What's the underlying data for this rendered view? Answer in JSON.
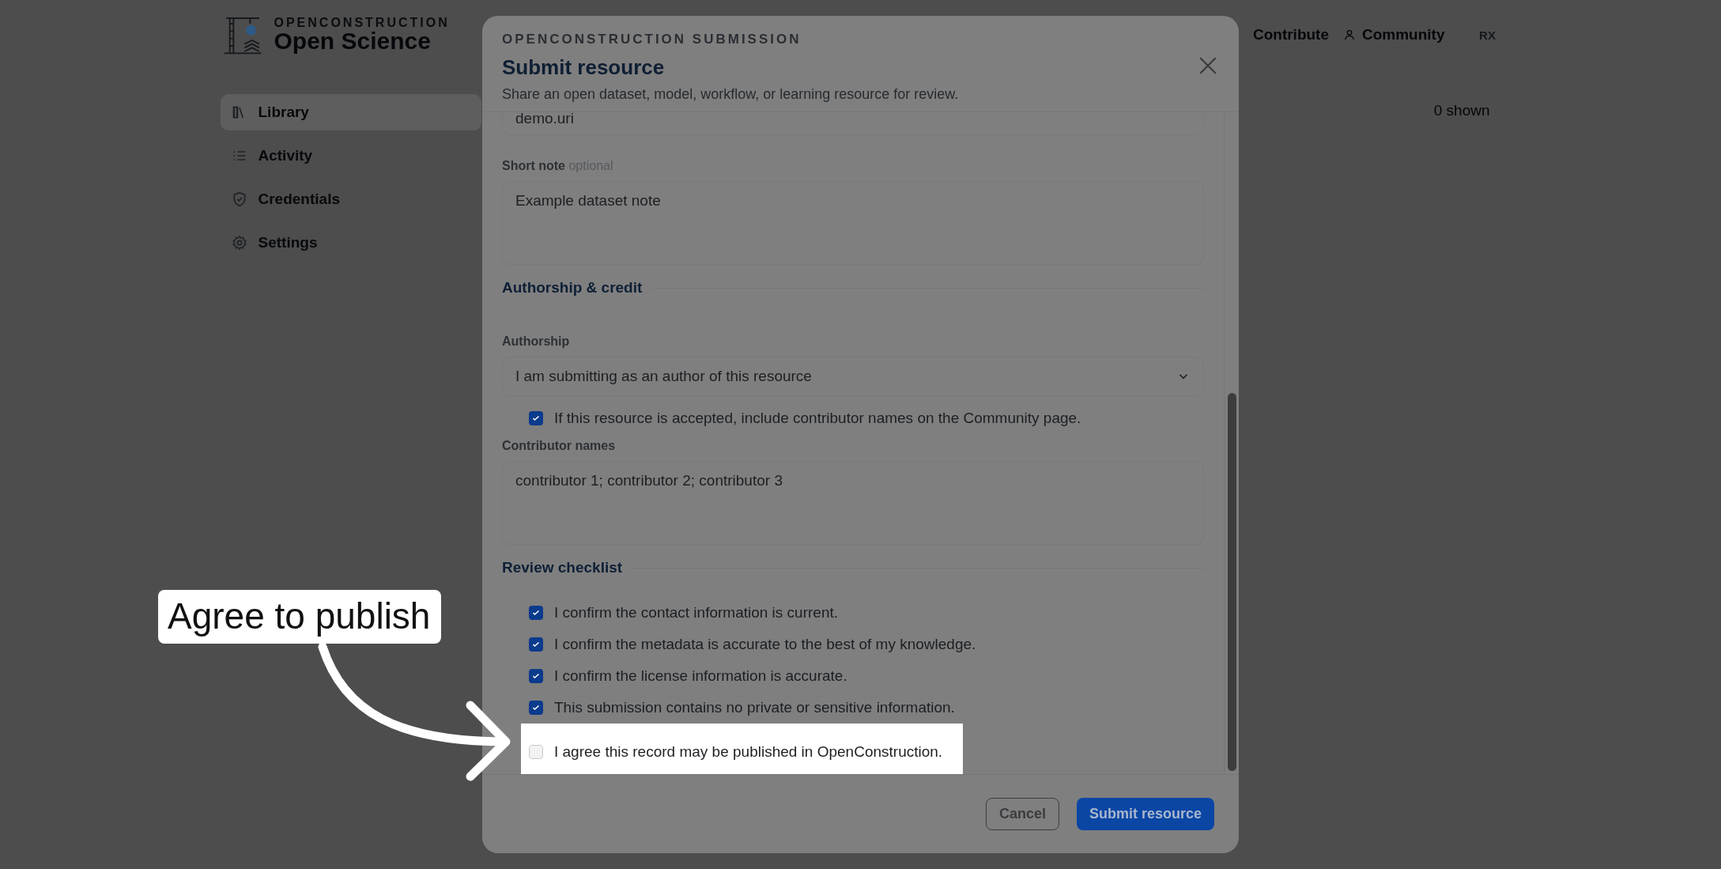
{
  "header": {
    "brand_kicker": "OPENCONSTRUCTION",
    "brand_name": "Open Science",
    "nav": [
      {
        "label": "Contribute"
      },
      {
        "label": "Community"
      }
    ],
    "avatar": "RX"
  },
  "sidebar": {
    "items": [
      {
        "label": "Library",
        "selected": true
      },
      {
        "label": "Activity",
        "selected": false
      },
      {
        "label": "Credentials",
        "selected": false
      },
      {
        "label": "Settings",
        "selected": false
      }
    ]
  },
  "content": {
    "count": "0 shown"
  },
  "dialog": {
    "kicker": "OPENCONSTRUCTION SUBMISSION",
    "title": "Submit resource",
    "subtitle": "Share an open dataset, model, workflow, or learning resource for review.",
    "url_field": {
      "value": "demo.uri"
    },
    "short_note": {
      "label": "Short note",
      "hint": "optional",
      "value": "Example dataset note"
    },
    "authorship_section": {
      "heading": "Authorship & credit",
      "select": {
        "label": "Authorship",
        "value": "I am submitting as an author of this resource"
      },
      "credit_checkbox": {
        "label": "If this resource is accepted, include contributor names on the Community page.",
        "checked": true
      },
      "contributors": {
        "label": "Contributor names",
        "value": "contributor 1; contributor 2; contributor 3"
      }
    },
    "review_section": {
      "heading": "Review checklist",
      "items": [
        {
          "label": "I confirm the contact information is current.",
          "checked": true,
          "highlighted": false
        },
        {
          "label": "I confirm the metadata is accurate to the best of my knowledge.",
          "checked": true,
          "highlighted": false
        },
        {
          "label": "I confirm the license information is accurate.",
          "checked": true,
          "highlighted": false
        },
        {
          "label": "This submission contains no private or sensitive information.",
          "checked": true,
          "highlighted": false
        },
        {
          "label": "I agree this record may be published in OpenConstruction.",
          "checked": false,
          "highlighted": true
        }
      ]
    },
    "buttons": [
      {
        "label": "Cancel",
        "kind": "secondary"
      },
      {
        "label": "Submit resource",
        "kind": "primary"
      }
    ]
  },
  "annotation": {
    "label": "Agree to publish"
  }
}
